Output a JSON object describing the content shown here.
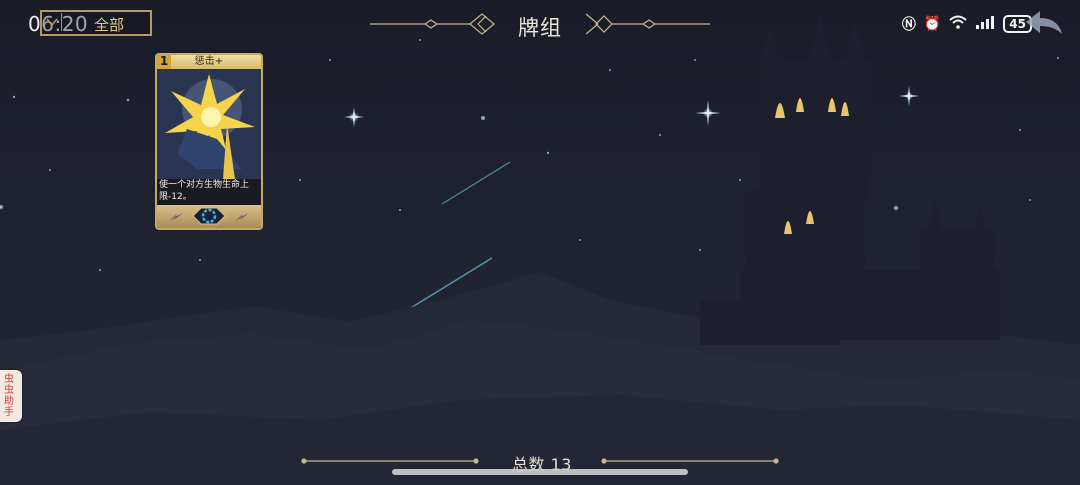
{
  "status_bar": {
    "time": "06:20",
    "battery": "45",
    "icons": [
      "nfc-icon",
      "alarm-icon",
      "wifi-icon",
      "signal-icon",
      "battery-icon"
    ]
  },
  "header": {
    "filter_label": "全部",
    "title": "牌组",
    "back_icon": "back-arrow-icon"
  },
  "cards": [
    {
      "name": "惩击+",
      "cost": "1",
      "description": "使一个对方生物生命上限-12。",
      "footer_icons": [
        "lightning-icon",
        "gear-icon",
        "lightning-icon"
      ]
    }
  ],
  "side_assistant": {
    "label": "虫虫助手"
  },
  "footer": {
    "total_label": "总数 13"
  },
  "colors": {
    "accent_gold": "#c7a869",
    "background": "#1c1f2c"
  }
}
